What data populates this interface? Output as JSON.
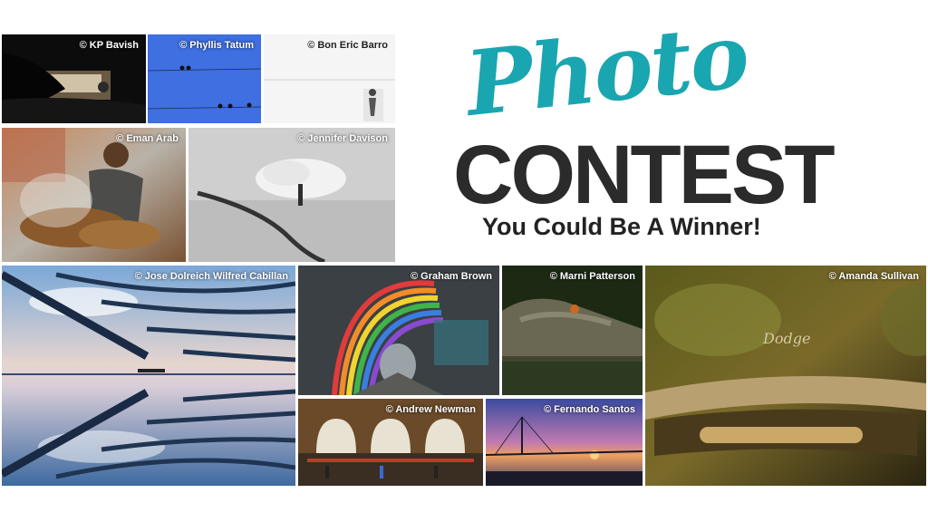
{
  "title": {
    "script_word": "Photo",
    "main_word": "CONTEST",
    "tagline": "You Could Be A Winner!"
  },
  "colors": {
    "accent": "#1aa6b0",
    "headline": "#2b2b2b"
  },
  "photos": {
    "kp": "© KP Bavish",
    "phyllis": "© Phyllis Tatum",
    "bon": "© Bon Eric Barro",
    "eman": "© Eman Arab",
    "jennifer": "© Jennifer Davison",
    "jose": "© Jose Dolreich Wilfred Cabillan",
    "graham": "© Graham Brown",
    "marni": "© Marni Patterson",
    "amanda": "© Amanda Sullivan",
    "andrew": "© Andrew Newman",
    "fernando": "© Fernando Santos"
  }
}
